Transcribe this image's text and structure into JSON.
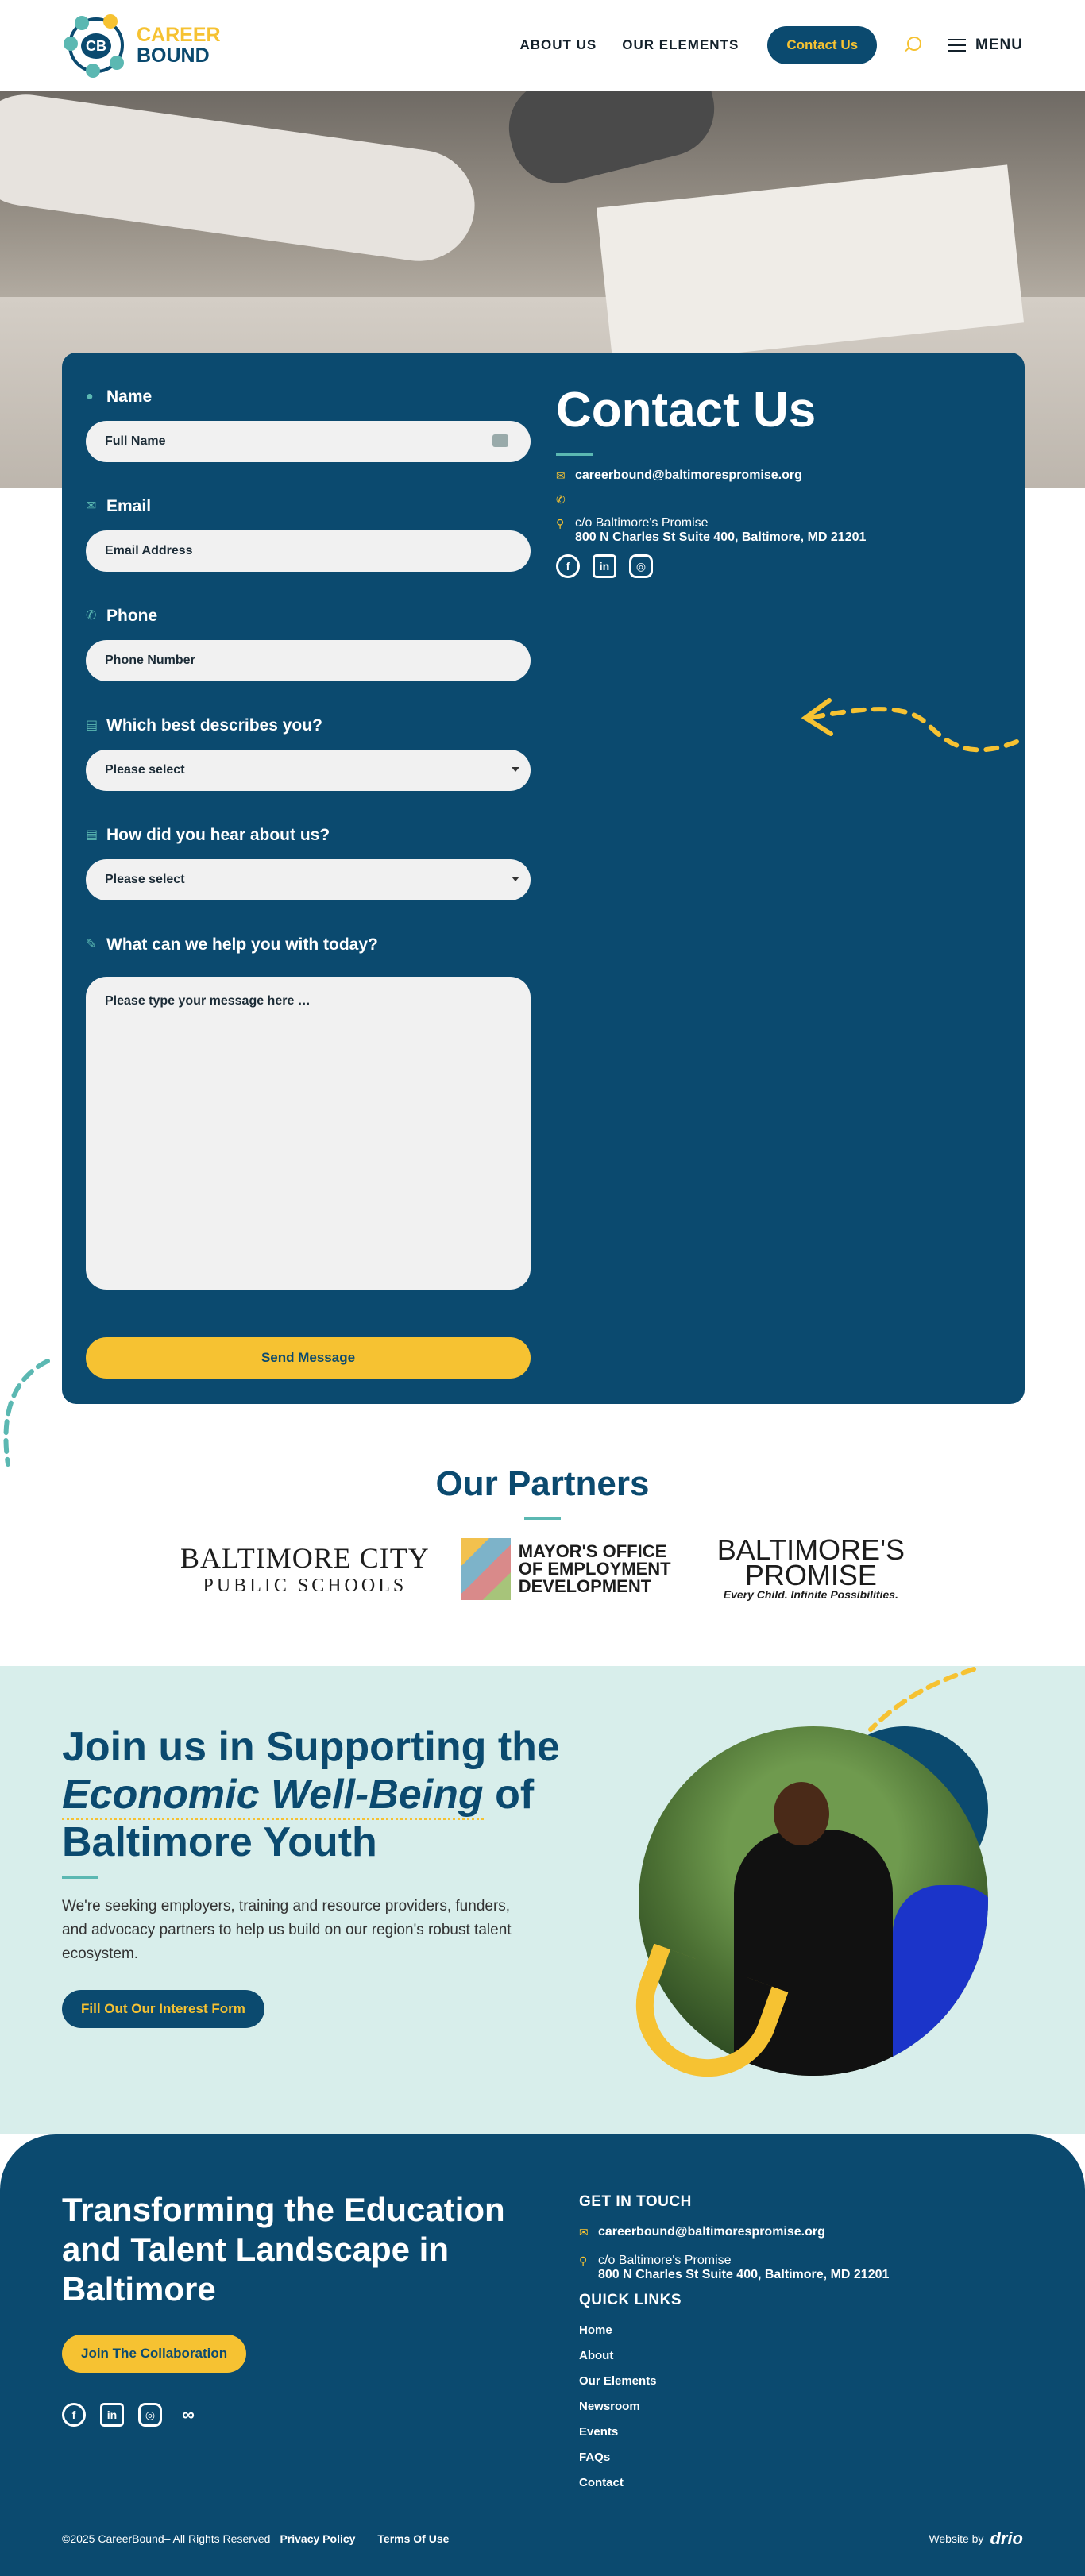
{
  "header": {
    "logo_line1": "CAREER",
    "logo_line2": "BOUND",
    "logo_mark": "CB",
    "nav": [
      "ABOUT US",
      "OUR ELEMENTS"
    ],
    "contact_button": "Contact Us",
    "menu_label": "MENU",
    "icons": {
      "search": "search-icon",
      "menu": "hamburger-icon"
    }
  },
  "form": {
    "name_label": "Name",
    "name_placeholder": "Full Name",
    "email_label": "Email",
    "email_placeholder": "Email Address",
    "phone_label": "Phone",
    "phone_placeholder": "Phone Number",
    "describe_label": "Which best describes you?",
    "describe_value": "Please select",
    "hear_label": "How did you hear about us?",
    "hear_value": "Please select",
    "help_label": "What can we help you with today?",
    "message_placeholder": "Please type your message here …",
    "submit_label": "Send Message"
  },
  "contact": {
    "title": "Contact Us",
    "email": "careerbound@baltimorespromise.org",
    "address_line1": "c/o Baltimore's Promise",
    "address_line2": "800 N Charles St Suite 400, Baltimore, MD 21201"
  },
  "partners": {
    "title": "Our Partners",
    "bcps_line1": "BALTIMORE CITY",
    "bcps_line2": "PUBLIC SCHOOLS",
    "moed": "MAYOR'S OFFICE OF EMPLOYMENT DEVELOPMENT",
    "bp_line1": "BALTIMORE'S",
    "bp_line2": "PROMISE",
    "bp_tagline": "Every Child. Infinite Possibilities."
  },
  "join": {
    "title_start": "Join us in Supporting the",
    "title_em": "Economic Well-Being",
    "title_of": "of",
    "title_end": "Baltimore Youth",
    "body": "We're seeking employers, training and resource providers, funders, and advocacy partners to help us build on our region's robust talent ecosystem.",
    "button": "Fill Out Our Interest Form"
  },
  "footer": {
    "title": "Transforming the Education and Talent Landscape in Baltimore",
    "button": "Join The Collaboration",
    "get_in_touch": "GET IN TOUCH",
    "email": "careerbound@baltimorespromise.org",
    "address_line1": "c/o Baltimore's Promise",
    "address_line2": "800 N Charles St Suite 400, Baltimore, MD 21201",
    "quick_links_title": "QUICK LINKS",
    "quick_links": [
      "Home",
      "About",
      "Our Elements",
      "Newsroom",
      "Events",
      "FAQs",
      "Contact"
    ],
    "copyright": "©2025 CareerBound– All Rights Reserved",
    "privacy": "Privacy Policy",
    "terms": "Terms Of Use",
    "website_by": "Website by",
    "agency": "drio"
  },
  "colors": {
    "navy": "#0b4a6f",
    "yellow": "#f6c232",
    "teal": "#5bb8b2",
    "mint": "#d8eeeb"
  }
}
